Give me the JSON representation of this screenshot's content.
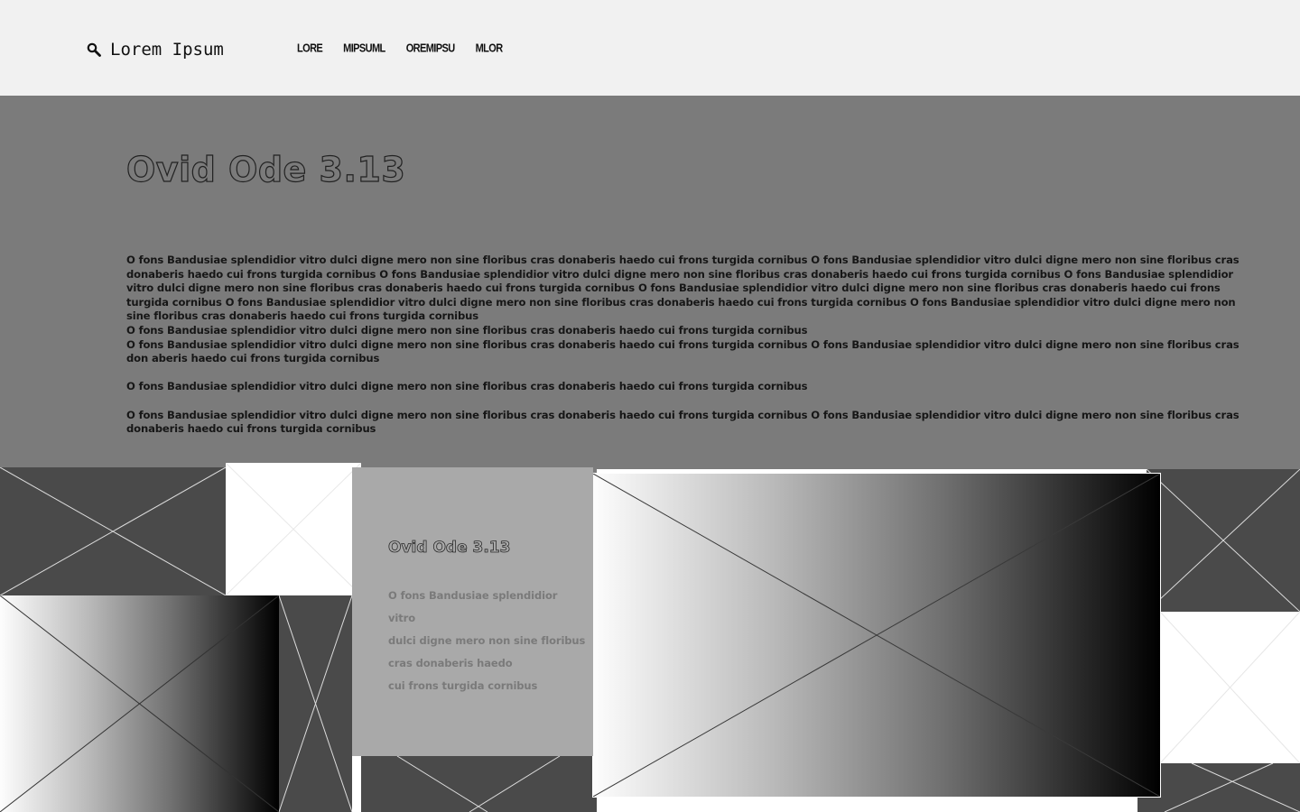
{
  "header": {
    "logo_text": "Lorem Ipsum",
    "logo_icon": "search-icon",
    "nav": [
      "LORE",
      "MIPSUML",
      "OREMIPSU",
      "MLOR"
    ]
  },
  "hero": {
    "title": "Ovid Ode 3.13",
    "paragraphs": [
      "O fons Bandusiae splendidior vitro dulci digne mero non sine floribus cras donaberis haedo cui frons turgida cornibus O fons Bandusiae splendidior vitro dulci digne mero non sine floribus cras donaberis haedo cui frons turgida cornibus O fons Bandusiae splendidior vitro dulci digne mero non sine floribus cras donaberis haedo cui frons turgida cornibus O fons Bandusiae splendidior vitro dulci digne mero non sine floribus cras donaberis haedo cui frons turgida cornibus O fons Bandusiae splendidior vitro dulci digne mero non sine floribus cras donaberis haedo cui frons turgida cornibus O fons Bandusiae splendidior vitro dulci digne mero non sine floribus cras donaberis haedo cui frons turgida cornibus O fons Bandusiae splendidior vitro dulci digne mero non sine floribus cras donaberis haedo cui frons turgida cornibus",
      "O fons Bandusiae splendidior vitro dulci digne mero non sine floribus cras donaberis haedo cui frons turgida cornibus",
      "O fons Bandusiae splendidior vitro dulci digne mero non sine floribus cras donaberis haedo cui frons turgida cornibus O fons Bandusiae splendidior vitro dulci digne mero non sine floribus cras don aberis haedo cui frons turgida cornibus",
      "O fons Bandusiae splendidior vitro dulci digne mero non sine floribus cras donaberis haedo cui frons turgida cornibus",
      "O fons Bandusiae splendidior vitro dulci digne mero non sine floribus cras donaberis haedo cui frons turgida cornibus O fons Bandusiae splendidior vitro dulci digne mero non sine floribus cras donaberis haedo cui frons turgida cornibus"
    ]
  },
  "card": {
    "title": "Ovid Ode 3.13",
    "text": "O fons Bandusiae splendidior vitro\ndulci digne mero non sine floribus\ncras donaberis haedo\ncui frons turgida cornibus"
  },
  "colors": {
    "header_bg": "#f1f1f1",
    "hero_bg": "#7b7b7b",
    "card_bg": "#a9a9a9",
    "dark_tile": "#4a4a4a"
  }
}
